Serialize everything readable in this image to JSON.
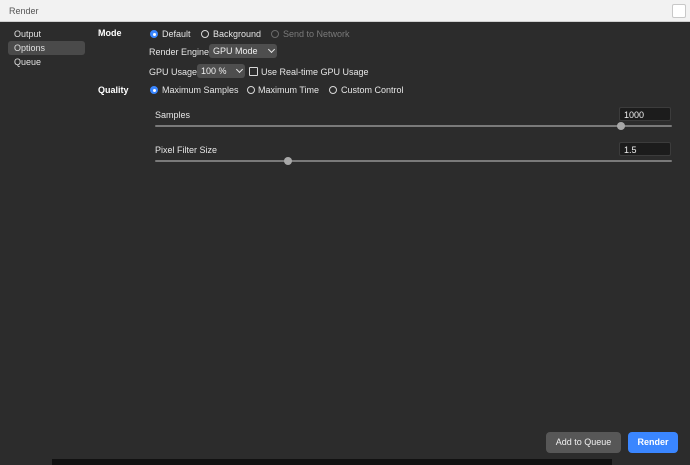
{
  "window": {
    "title": "Render"
  },
  "sidebar": {
    "items": [
      {
        "label": "Output"
      },
      {
        "label": "Options"
      },
      {
        "label": "Queue"
      }
    ],
    "active_index": 1
  },
  "mode": {
    "label": "Mode",
    "options": [
      "Default",
      "Background",
      "Send to Network"
    ],
    "selected": "Default",
    "disabled": [
      "Send to Network"
    ]
  },
  "render_engine": {
    "label": "Render Engine",
    "value": "GPU Mode"
  },
  "gpu_usage": {
    "label": "GPU Usage",
    "value": "100 %",
    "realtime_label": "Use Real-time GPU Usage",
    "realtime_checked": false
  },
  "quality": {
    "label": "Quality",
    "options": [
      "Maximum Samples",
      "Maximum Time",
      "Custom Control"
    ],
    "selected": "Maximum Samples"
  },
  "samples": {
    "label": "Samples",
    "value": "1000",
    "level": 1.0
  },
  "pixel_filter": {
    "label": "Pixel Filter Size",
    "value": "1.5",
    "level": 0.28
  },
  "footer": {
    "add_to_queue": "Add to Queue",
    "render": "Render"
  },
  "colors": {
    "accent": "#3a86ff",
    "background": "#2c2c2c",
    "field": "#1c1c1c"
  }
}
